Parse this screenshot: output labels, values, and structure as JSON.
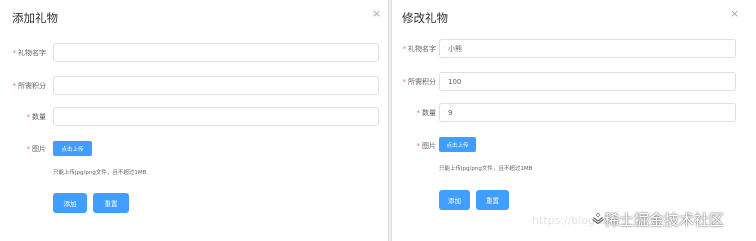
{
  "add_dialog": {
    "title": "添加礼物",
    "close_glyph": "×",
    "fields": [
      {
        "label": "礼物名字",
        "required": true,
        "value": ""
      },
      {
        "label": "所需积分",
        "required": true,
        "value": ""
      },
      {
        "label": "数量",
        "required": true,
        "value": ""
      }
    ],
    "image_label": "图片",
    "image_required": true,
    "upload_label": "点击上传",
    "upload_tip": "只能上传jpg/png文件，且不超过1MB",
    "add_label": "添加",
    "reset_label": "重置"
  },
  "edit_dialog": {
    "title": "修改礼物",
    "close_glyph": "×",
    "fields": [
      {
        "label": "礼物名字",
        "required": true,
        "value": "小熊"
      },
      {
        "label": "所需积分",
        "required": true,
        "value": "100"
      },
      {
        "label": "数量",
        "required": true,
        "value": "9"
      }
    ],
    "image_label": "图片",
    "image_required": true,
    "upload_label": "点击上传",
    "upload_tip": "只能上传jpg/png文件，且不超过1MB",
    "add_label": "添加",
    "reset_label": "重置"
  },
  "watermark": {
    "url_text": "https://blog.csdn",
    "brand_text": "稀土掘金技术社区"
  },
  "colors": {
    "primary": "#409eff",
    "required_star": "#f56c6c",
    "border": "#dcdfe6"
  }
}
